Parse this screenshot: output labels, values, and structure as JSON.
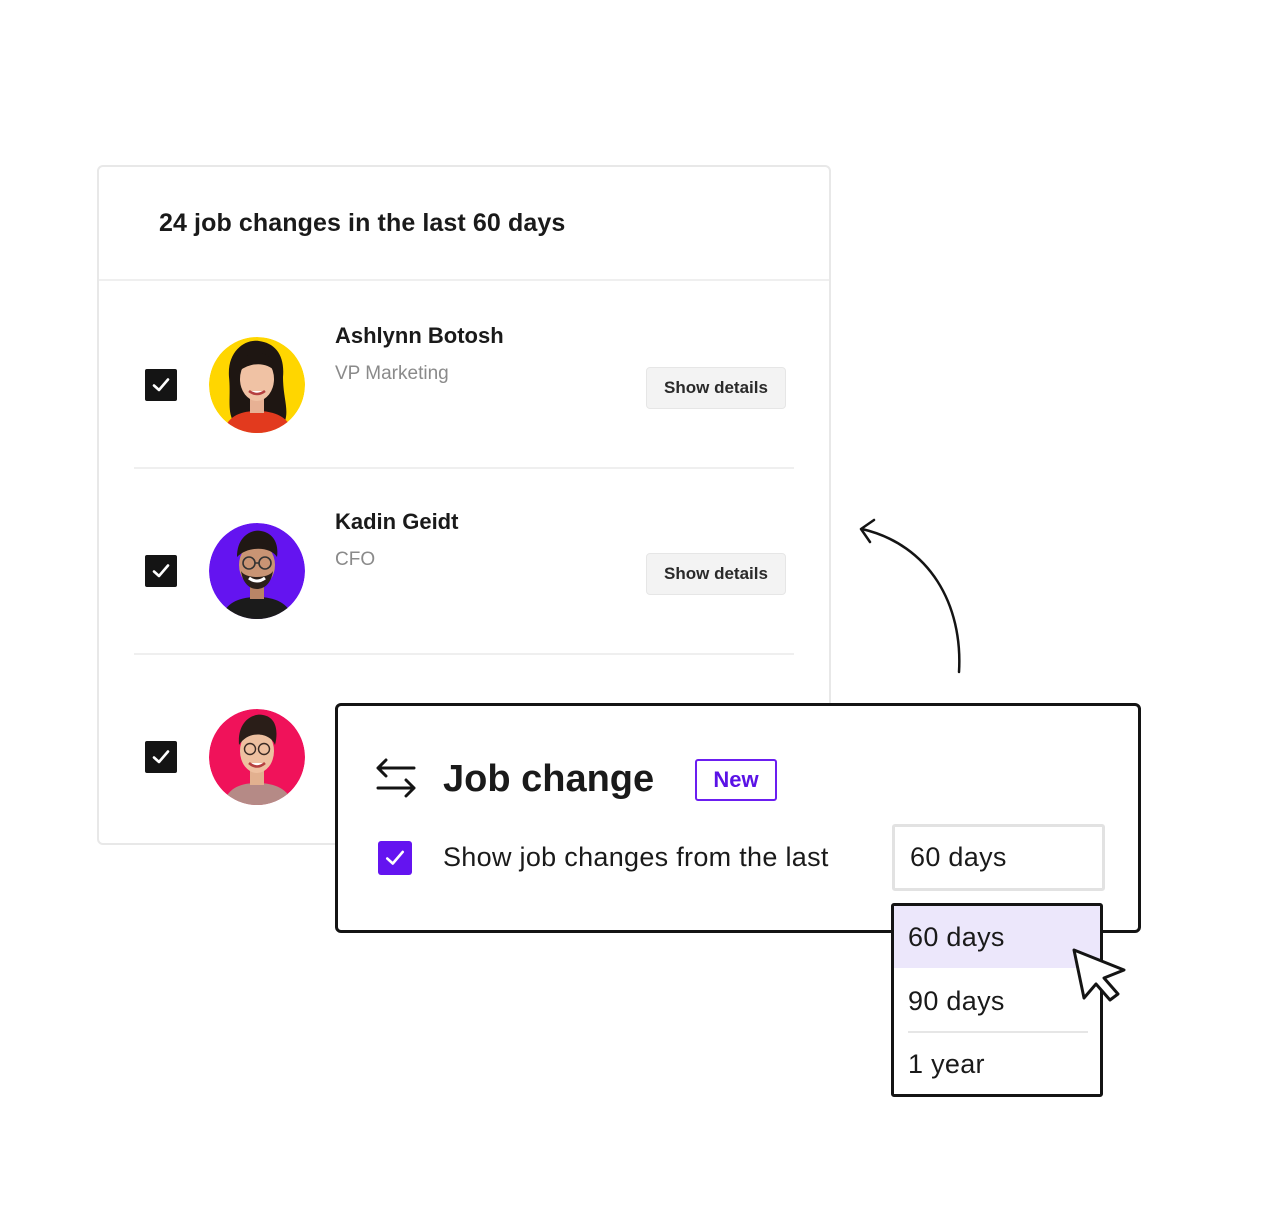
{
  "card": {
    "title": "24 job changes in the last 60 days",
    "people": [
      {
        "name": "Ashlynn Botosh",
        "title": "VP Marketing",
        "avatar_bg": "#FFD600",
        "details_label": "Show details",
        "checked": true
      },
      {
        "name": "Kadin Geidt",
        "title": "CFO",
        "avatar_bg": "#6414F0",
        "details_label": "Show details",
        "checked": true
      },
      {
        "name": "",
        "title": "",
        "avatar_bg": "#F0125A",
        "checked": true
      }
    ]
  },
  "popup": {
    "icon": "swap-arrows-icon",
    "title": "Job change",
    "badge": "New",
    "option_label": "Show job changes from the last",
    "option_checked": true,
    "selected_value": "60 days"
  },
  "dropdown": {
    "options": [
      "60 days",
      "90 days",
      "1 year"
    ],
    "highlighted": "60 days"
  },
  "colors": {
    "accent": "#6414F0",
    "dark": "#141414",
    "highlight": "#ECE7FB"
  }
}
